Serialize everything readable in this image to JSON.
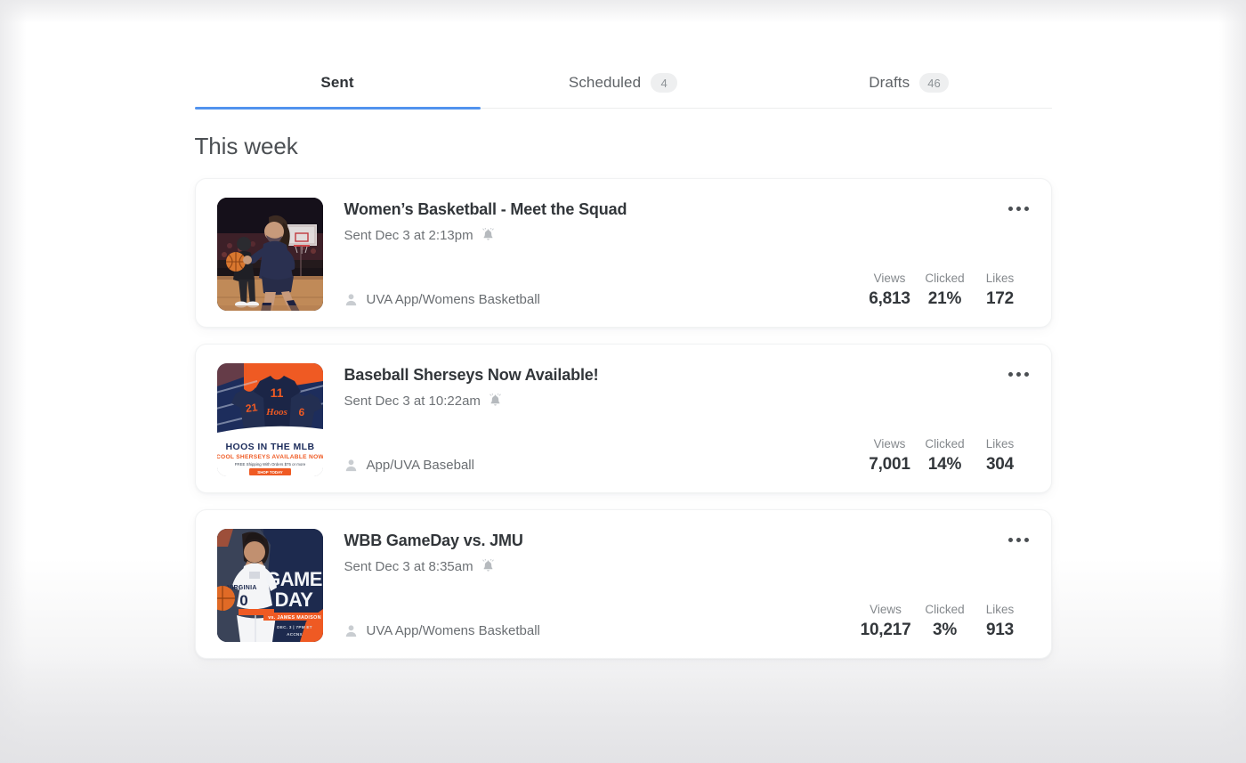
{
  "tabs": [
    {
      "label": "Sent",
      "badge": null,
      "active": true
    },
    {
      "label": "Scheduled",
      "badge": "4",
      "active": false
    },
    {
      "label": "Drafts",
      "badge": "46",
      "active": false
    }
  ],
  "section": {
    "title": "This week"
  },
  "stat_labels": {
    "views": "Views",
    "clicked": "Clicked",
    "likes": "Likes"
  },
  "icons": {
    "bell": "bell-icon",
    "person": "person-icon",
    "more": "more-options-icon"
  },
  "colors": {
    "active_tab_underline": "#5193ee",
    "badge_bg": "#eeeff0",
    "card_bg": "#ffffff",
    "page_bg": "#ffffff",
    "title_text": "#32363a",
    "muted_text": "#6e7276"
  },
  "messages": [
    {
      "title": "Women’s Basketball - Meet the Squad",
      "sent": "Sent Dec 3 at 2:13pm",
      "channel": "UVA App/Womens Basketball",
      "views": "6,813",
      "clicked": "21%",
      "likes": "172",
      "thumbnail": "womens-basketball-player-dribbling-photo"
    },
    {
      "title": "Baseball Sherseys Now Available!",
      "sent": "Sent Dec 3 at 10:22am",
      "channel": "App/UVA Baseball",
      "views": "7,001",
      "clicked": "14%",
      "likes": "304",
      "thumbnail": "hoos-in-the-mlb-shersey-promo-graphic",
      "thumbnail_text": {
        "headline": "HOOS IN THE MLB",
        "subhead": "COOL SHERSEYS AVAILABLE NOW",
        "fineprint": "FREE Shipping With Orders $75 or more",
        "cta": "SHOP TODAY"
      }
    },
    {
      "title": "WBB GameDay vs. JMU",
      "sent": "Sent Dec 3 at 8:35am",
      "channel": "UVA App/Womens Basketball",
      "views": "10,217",
      "clicked": "3%",
      "likes": "913",
      "thumbnail": "wbb-gameday-vs-jmu-graphic",
      "thumbnail_text": {
        "line1": "GAME",
        "line2": "DAY",
        "line3": "vs. JAMES MADISON",
        "line4": "DEC. 3 | 7PM ET",
        "line5": "ACCNX",
        "jersey": "VIRGINIA",
        "number": "0"
      }
    }
  ]
}
